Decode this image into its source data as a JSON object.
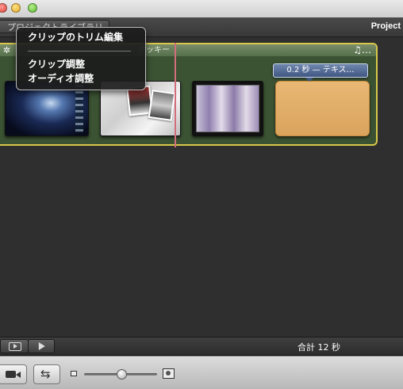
{
  "window": {
    "title_tab": "プロジェクトライブラリ",
    "project_label": "Project"
  },
  "strip": {
    "name": "クッキー",
    "tooltip": "0.2 秒 — テキス…"
  },
  "context_menu": {
    "items": [
      "クリップのトリム編集",
      "クリップ調整",
      "オーディオ調整"
    ]
  },
  "toolbar": {
    "total_duration": "合計 12 秒"
  },
  "zoom_slider": {
    "value": 0.5
  },
  "colors": {
    "strip_border": "#d8c84a",
    "strip_fill": "#3b5233",
    "playhead": "#d26e7b",
    "tooltip": "#3f5782",
    "title_clip": "#e2ae68"
  }
}
